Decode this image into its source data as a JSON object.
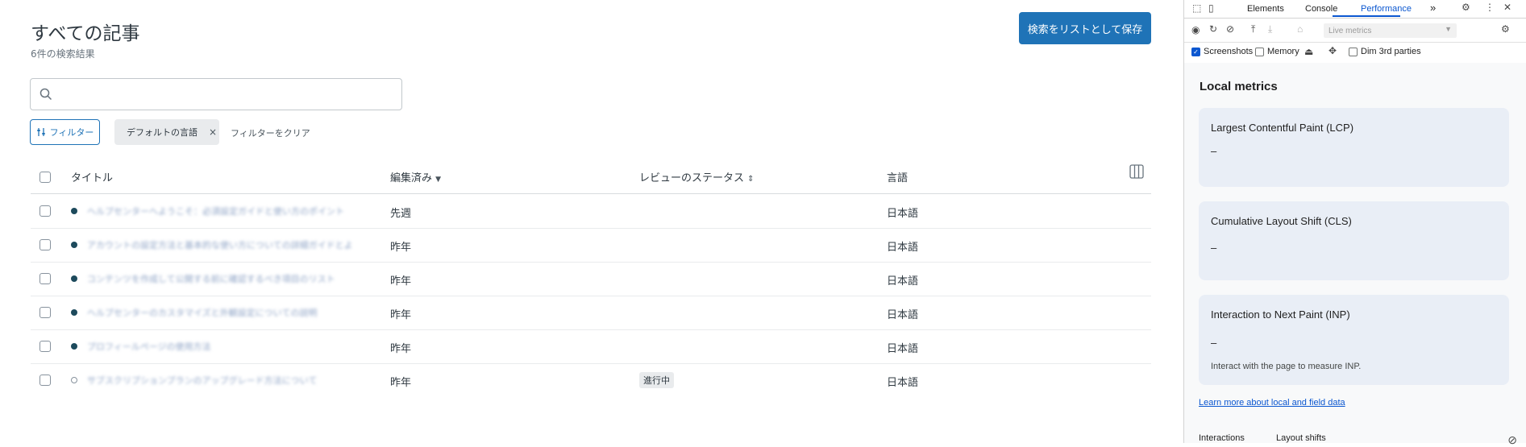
{
  "main": {
    "title": "すべての記事",
    "result_count": "6件の検索結果",
    "save_search_label": "検索をリストとして保存",
    "search": {
      "value": "",
      "placeholder": ""
    },
    "filter_button": "フィルター",
    "filter_tag": "デフォルトの言語",
    "filter_tag_remove": "×",
    "clear_filters": "フィルターをクリア",
    "columns": {
      "title": "タイトル",
      "edited": "編集済み",
      "review_status": "レビューのステータス",
      "language": "言語"
    },
    "rows": [
      {
        "title": "ヘルプセンターへようこそ：必須設定ガイドと使い方のポイント",
        "edited": "先週",
        "status": "",
        "language": "日本語",
        "published": true
      },
      {
        "title": "アカウントの設定方法と基本的な使い方についての詳細ガイドとよくある質問",
        "edited": "昨年",
        "status": "",
        "language": "日本語",
        "published": true
      },
      {
        "title": "コンテンツを作成して公開する前に確認するべき項目のリスト",
        "edited": "昨年",
        "status": "",
        "language": "日本語",
        "published": true
      },
      {
        "title": "ヘルプセンターのカスタマイズと外観設定についての説明",
        "edited": "昨年",
        "status": "",
        "language": "日本語",
        "published": true
      },
      {
        "title": "プロフィールページの使用方法",
        "edited": "昨年",
        "status": "",
        "language": "日本語",
        "published": true
      },
      {
        "title": "サブスクリプションプランのアップグレード方法について",
        "edited": "昨年",
        "status": "進行中",
        "language": "日本語",
        "published": false
      }
    ]
  },
  "devtools": {
    "tabs": [
      "Elements",
      "Console",
      "Performance"
    ],
    "active_tab": "Performance",
    "more_tabs": "»",
    "live_metrics_select": "Live metrics",
    "checkboxes": [
      {
        "label": "Screenshots",
        "checked": true
      },
      {
        "label": "Memory",
        "checked": false
      },
      {
        "label": "Dim 3rd parties",
        "checked": false
      }
    ],
    "local_metrics_title": "Local metrics",
    "metrics": [
      {
        "name": "Largest Contentful Paint (LCP)",
        "value": "–",
        "hint": ""
      },
      {
        "name": "Cumulative Layout Shift (CLS)",
        "value": "–",
        "hint": ""
      },
      {
        "name": "Interaction to Next Paint (INP)",
        "value": "–",
        "hint": "Interact with the page to measure INP."
      }
    ],
    "learn_more": "Learn more about local and field data",
    "bottom_tabs": [
      "Interactions",
      "Layout shifts"
    ]
  },
  "colors": {
    "primary": "#1f73b7",
    "devtools_accent": "#0b57d0",
    "card_bg": "#e9eef6"
  }
}
